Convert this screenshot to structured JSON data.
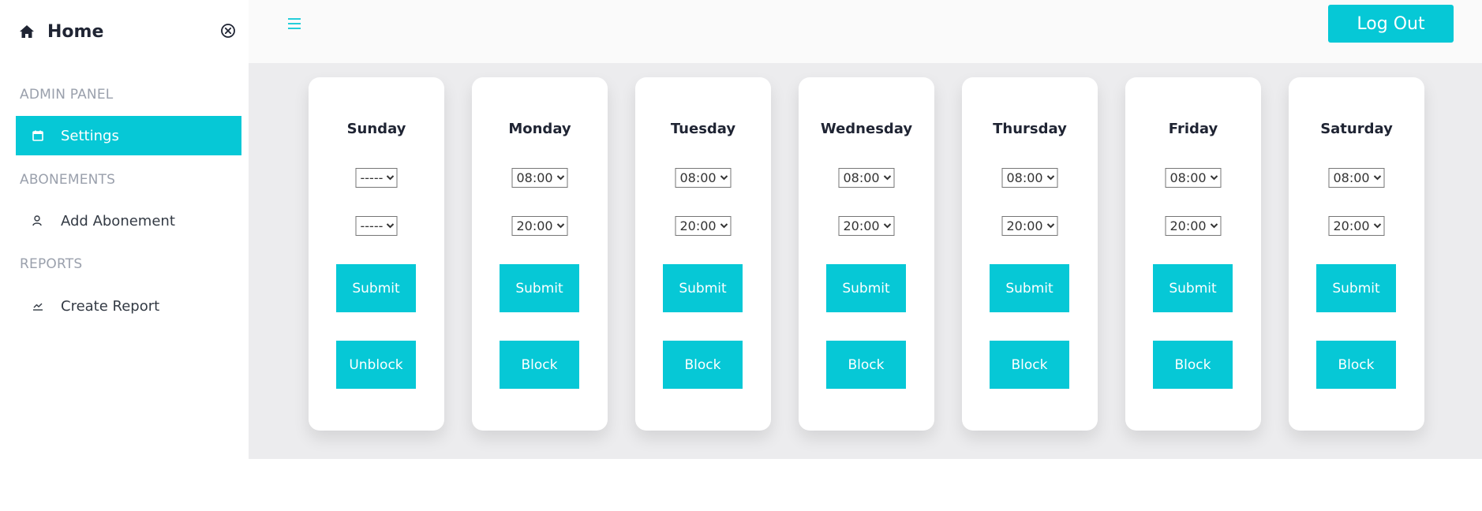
{
  "sidebar": {
    "title": "Home",
    "sections": [
      {
        "heading": "ADMIN PANEL",
        "items": [
          {
            "label": "Settings",
            "icon": "calendar-icon",
            "active": true
          }
        ]
      },
      {
        "heading": "ABONEMENTS",
        "items": [
          {
            "label": "Add Abonement",
            "icon": "user-icon",
            "active": false
          }
        ]
      },
      {
        "heading": "REPORTS",
        "items": [
          {
            "label": "Create Report",
            "icon": "chart-line-icon",
            "active": false
          }
        ]
      }
    ]
  },
  "topbar": {
    "logout_label": "Log Out"
  },
  "colors": {
    "accent": "#06c8d6",
    "main_bg": "#ececee",
    "topbar_bg": "#fafafa"
  },
  "days": [
    {
      "name": "Sunday",
      "start": "-----",
      "end": "-----",
      "submit_label": "Submit",
      "toggle_label": "Unblock"
    },
    {
      "name": "Monday",
      "start": "08:00",
      "end": "20:00",
      "submit_label": "Submit",
      "toggle_label": "Block"
    },
    {
      "name": "Tuesday",
      "start": "08:00",
      "end": "20:00",
      "submit_label": "Submit",
      "toggle_label": "Block"
    },
    {
      "name": "Wednesday",
      "start": "08:00",
      "end": "20:00",
      "submit_label": "Submit",
      "toggle_label": "Block"
    },
    {
      "name": "Thursday",
      "start": "08:00",
      "end": "20:00",
      "submit_label": "Submit",
      "toggle_label": "Block"
    },
    {
      "name": "Friday",
      "start": "08:00",
      "end": "20:00",
      "submit_label": "Submit",
      "toggle_label": "Block"
    },
    {
      "name": "Saturday",
      "start": "08:00",
      "end": "20:00",
      "submit_label": "Submit",
      "toggle_label": "Block"
    }
  ]
}
